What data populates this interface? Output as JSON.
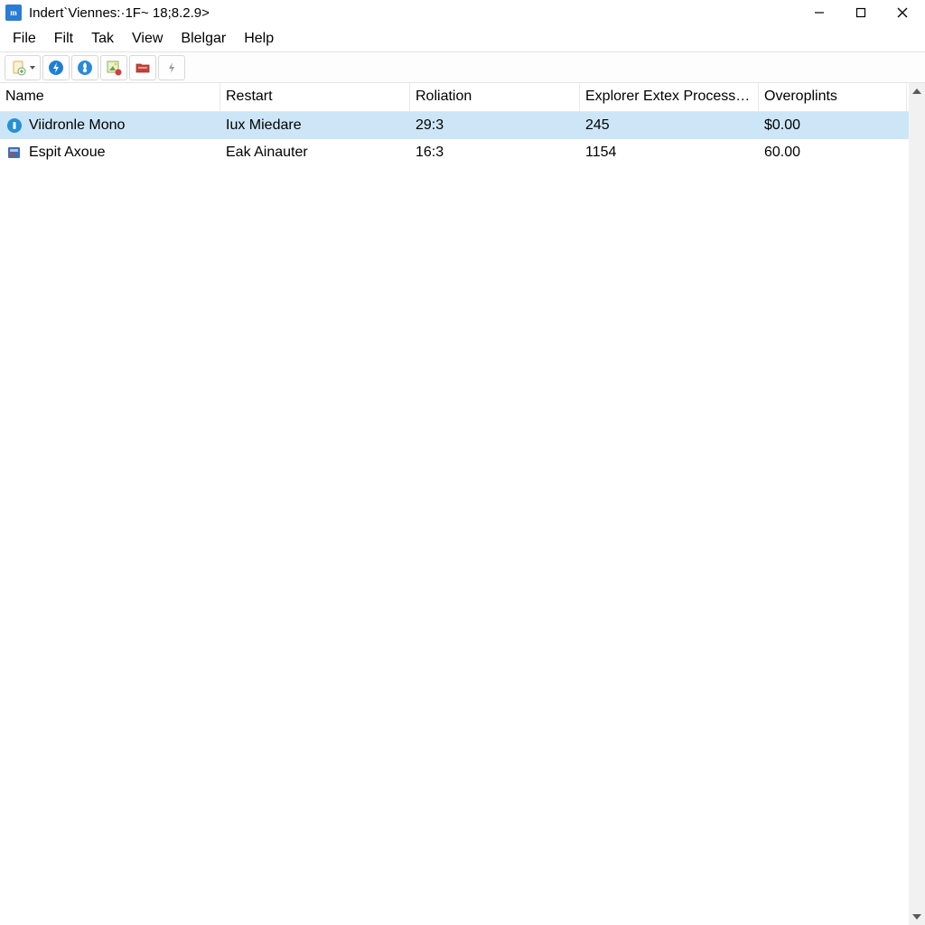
{
  "window": {
    "title": "Indert`Viennes:·1F~ 18;8.2.9>"
  },
  "menu": {
    "file": "File",
    "filt": "Filt",
    "tak": "Tak",
    "view": "View",
    "blelgar": "Blelgar",
    "help": "Help"
  },
  "columns": {
    "name": "Name",
    "restart": "Restart",
    "roliation": "Roliation",
    "explorer": "Explorer Extex Process ;…",
    "over": "Overoplints"
  },
  "rows": [
    {
      "name": "Viidronle Mono",
      "restart": "Iux Miedare",
      "roliation": "29:3",
      "explorer": "245",
      "over": "$0.00",
      "selected": true,
      "icon": "info-circle-icon"
    },
    {
      "name": "Espit Axoue",
      "restart": "Eak Ainauter",
      "roliation": "16:3",
      "explorer": "1154",
      "over": "60.00",
      "selected": false,
      "icon": "app-square-icon"
    }
  ]
}
